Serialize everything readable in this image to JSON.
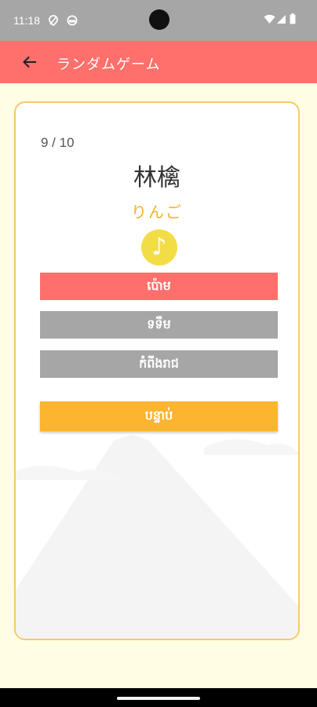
{
  "status_bar": {
    "time": "11:18",
    "icons": [
      "location-icon",
      "smiley-icon",
      "wifi-icon",
      "signal-icon",
      "battery-icon"
    ]
  },
  "app_bar": {
    "title": "ランダムゲーム",
    "back_icon": "arrow-left-icon"
  },
  "quiz": {
    "progress": "9 / 10",
    "word": "林檎",
    "reading": "りんご",
    "audio_icon": "music-note-icon",
    "answers": [
      {
        "label": "ប៉ោម",
        "state": "selected"
      },
      {
        "label": "ទទឹម",
        "state": "default"
      },
      {
        "label": "កំពីងរាជ",
        "state": "default"
      }
    ],
    "next_label": "បន្ទាប់"
  },
  "colors": {
    "status_bar": "#a6a6a6",
    "app_bar": "#ff6f6b",
    "background": "#fffde3",
    "card_border": "#f9c86a",
    "reading": "#f4b02b",
    "audio_button": "#f3dd46",
    "selected_answer": "#ff6f6b",
    "default_answer": "#a6a6a6",
    "next_button": "#fbb52e"
  }
}
